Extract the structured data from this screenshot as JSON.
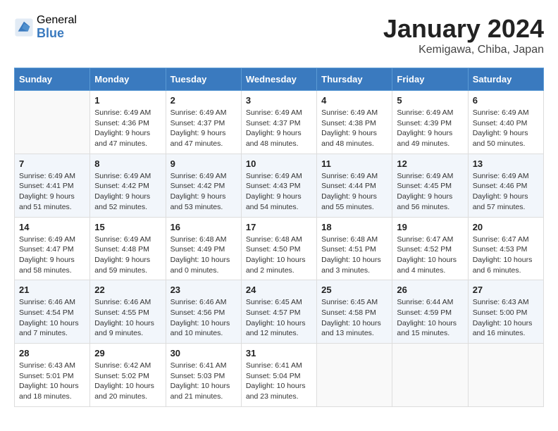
{
  "header": {
    "logo_general": "General",
    "logo_blue": "Blue",
    "title": "January 2024",
    "subtitle": "Kemigawa, Chiba, Japan"
  },
  "weekdays": [
    "Sunday",
    "Monday",
    "Tuesday",
    "Wednesday",
    "Thursday",
    "Friday",
    "Saturday"
  ],
  "weeks": [
    [
      {
        "day": "",
        "info": ""
      },
      {
        "day": "1",
        "info": "Sunrise: 6:49 AM\nSunset: 4:36 PM\nDaylight: 9 hours\nand 47 minutes."
      },
      {
        "day": "2",
        "info": "Sunrise: 6:49 AM\nSunset: 4:37 PM\nDaylight: 9 hours\nand 47 minutes."
      },
      {
        "day": "3",
        "info": "Sunrise: 6:49 AM\nSunset: 4:37 PM\nDaylight: 9 hours\nand 48 minutes."
      },
      {
        "day": "4",
        "info": "Sunrise: 6:49 AM\nSunset: 4:38 PM\nDaylight: 9 hours\nand 48 minutes."
      },
      {
        "day": "5",
        "info": "Sunrise: 6:49 AM\nSunset: 4:39 PM\nDaylight: 9 hours\nand 49 minutes."
      },
      {
        "day": "6",
        "info": "Sunrise: 6:49 AM\nSunset: 4:40 PM\nDaylight: 9 hours\nand 50 minutes."
      }
    ],
    [
      {
        "day": "7",
        "info": "Sunrise: 6:49 AM\nSunset: 4:41 PM\nDaylight: 9 hours\nand 51 minutes."
      },
      {
        "day": "8",
        "info": "Sunrise: 6:49 AM\nSunset: 4:42 PM\nDaylight: 9 hours\nand 52 minutes."
      },
      {
        "day": "9",
        "info": "Sunrise: 6:49 AM\nSunset: 4:42 PM\nDaylight: 9 hours\nand 53 minutes."
      },
      {
        "day": "10",
        "info": "Sunrise: 6:49 AM\nSunset: 4:43 PM\nDaylight: 9 hours\nand 54 minutes."
      },
      {
        "day": "11",
        "info": "Sunrise: 6:49 AM\nSunset: 4:44 PM\nDaylight: 9 hours\nand 55 minutes."
      },
      {
        "day": "12",
        "info": "Sunrise: 6:49 AM\nSunset: 4:45 PM\nDaylight: 9 hours\nand 56 minutes."
      },
      {
        "day": "13",
        "info": "Sunrise: 6:49 AM\nSunset: 4:46 PM\nDaylight: 9 hours\nand 57 minutes."
      }
    ],
    [
      {
        "day": "14",
        "info": "Sunrise: 6:49 AM\nSunset: 4:47 PM\nDaylight: 9 hours\nand 58 minutes."
      },
      {
        "day": "15",
        "info": "Sunrise: 6:49 AM\nSunset: 4:48 PM\nDaylight: 9 hours\nand 59 minutes."
      },
      {
        "day": "16",
        "info": "Sunrise: 6:48 AM\nSunset: 4:49 PM\nDaylight: 10 hours\nand 0 minutes."
      },
      {
        "day": "17",
        "info": "Sunrise: 6:48 AM\nSunset: 4:50 PM\nDaylight: 10 hours\nand 2 minutes."
      },
      {
        "day": "18",
        "info": "Sunrise: 6:48 AM\nSunset: 4:51 PM\nDaylight: 10 hours\nand 3 minutes."
      },
      {
        "day": "19",
        "info": "Sunrise: 6:47 AM\nSunset: 4:52 PM\nDaylight: 10 hours\nand 4 minutes."
      },
      {
        "day": "20",
        "info": "Sunrise: 6:47 AM\nSunset: 4:53 PM\nDaylight: 10 hours\nand 6 minutes."
      }
    ],
    [
      {
        "day": "21",
        "info": "Sunrise: 6:46 AM\nSunset: 4:54 PM\nDaylight: 10 hours\nand 7 minutes."
      },
      {
        "day": "22",
        "info": "Sunrise: 6:46 AM\nSunset: 4:55 PM\nDaylight: 10 hours\nand 9 minutes."
      },
      {
        "day": "23",
        "info": "Sunrise: 6:46 AM\nSunset: 4:56 PM\nDaylight: 10 hours\nand 10 minutes."
      },
      {
        "day": "24",
        "info": "Sunrise: 6:45 AM\nSunset: 4:57 PM\nDaylight: 10 hours\nand 12 minutes."
      },
      {
        "day": "25",
        "info": "Sunrise: 6:45 AM\nSunset: 4:58 PM\nDaylight: 10 hours\nand 13 minutes."
      },
      {
        "day": "26",
        "info": "Sunrise: 6:44 AM\nSunset: 4:59 PM\nDaylight: 10 hours\nand 15 minutes."
      },
      {
        "day": "27",
        "info": "Sunrise: 6:43 AM\nSunset: 5:00 PM\nDaylight: 10 hours\nand 16 minutes."
      }
    ],
    [
      {
        "day": "28",
        "info": "Sunrise: 6:43 AM\nSunset: 5:01 PM\nDaylight: 10 hours\nand 18 minutes."
      },
      {
        "day": "29",
        "info": "Sunrise: 6:42 AM\nSunset: 5:02 PM\nDaylight: 10 hours\nand 20 minutes."
      },
      {
        "day": "30",
        "info": "Sunrise: 6:41 AM\nSunset: 5:03 PM\nDaylight: 10 hours\nand 21 minutes."
      },
      {
        "day": "31",
        "info": "Sunrise: 6:41 AM\nSunset: 5:04 PM\nDaylight: 10 hours\nand 23 minutes."
      },
      {
        "day": "",
        "info": ""
      },
      {
        "day": "",
        "info": ""
      },
      {
        "day": "",
        "info": ""
      }
    ]
  ]
}
